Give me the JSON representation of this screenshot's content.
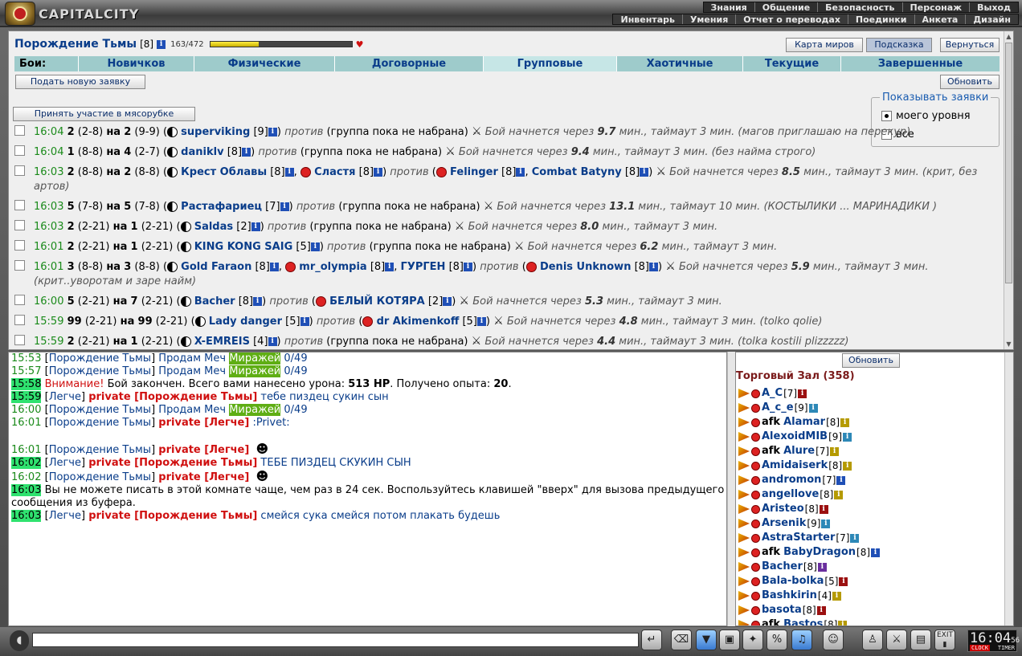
{
  "app": {
    "brand": "CAPITALCITY"
  },
  "menu_top": [
    "Знания",
    "Общение",
    "Безопасность",
    "Персонаж",
    "Выход"
  ],
  "menu_sub": [
    "Инвентарь",
    "Умения",
    "Отчет о переводах",
    "Поединки",
    "Анкета",
    "Дизайн"
  ],
  "header": {
    "nick": "Порождение Тьмы",
    "level": "[8]",
    "hp_text": "163/472",
    "hp_fraction": 0.345
  },
  "buttons": {
    "map": "Карта миров",
    "hint": "Подсказка",
    "back": "Вернуться",
    "new_request": "Подать новую заявку",
    "refresh": "Обновить",
    "join": "Принять участие в мясорубке"
  },
  "tabs": {
    "label": "Бои:",
    "items": [
      "Новичков",
      "Физические",
      "Договорные",
      "Групповые",
      "Хаотичные",
      "Текущие",
      "Завершенные"
    ],
    "selected": "Групповые"
  },
  "show_box": {
    "title": "Показывать заявки",
    "opt1": "моего уровня",
    "opt2": "все"
  },
  "fights": [
    {
      "time": "16:04",
      "a": "2",
      "ar": "(2-8)",
      "b": "2",
      "br": "(9-9)",
      "lead": "superviking",
      "lvl": "[9]",
      "vs": "(группа пока не набрана)",
      "mins": "9.7",
      "tmo": "3",
      "note": "(магов приглашаю на перекур)"
    },
    {
      "time": "16:04",
      "a": "1",
      "ar": "(8-8)",
      "b": "4",
      "br": "(2-7)",
      "lead": "daniklv",
      "lvl": "[8]",
      "vs": "(группа пока не набрана)",
      "mins": "9.4",
      "tmo": "3",
      "note": "(без найма строго)"
    },
    {
      "time": "16:03",
      "a": "2",
      "ar": "(8-8)",
      "b": "2",
      "br": "(8-8)",
      "lead": "Крест Облавы",
      "lvl": "[8]",
      "lead2": "Сластя",
      "lvl2": "[8]",
      "vs1": "Felinger",
      "vsl1": "[8]",
      "vs2": "Combat Batyny",
      "vsl2": "[8]",
      "mins": "8.5",
      "tmo": "3",
      "note": "(крит, без артов)"
    },
    {
      "time": "16:03",
      "a": "5",
      "ar": "(7-8)",
      "b": "5",
      "br": "(7-8)",
      "lead": "Растафариец",
      "lvl": "[7]",
      "vs": "(группа пока не набрана)",
      "mins": "13.1",
      "tmo": "10",
      "note": "(КОСТЫЛИКИ ... МАРИНАДИКИ )"
    },
    {
      "time": "16:03",
      "a": "2",
      "ar": "(2-21)",
      "b": "1",
      "br": "(2-21)",
      "lead": "Saldas",
      "lvl": "[2]",
      "vs": "(группа пока не набрана)",
      "mins": "8.0",
      "tmo": "3",
      "note": ""
    },
    {
      "time": "16:01",
      "a": "2",
      "ar": "(2-21)",
      "b": "1",
      "br": "(2-21)",
      "lead": "KING KONG SAIG",
      "lvl": "[5]",
      "vs": "(группа пока не набрана)",
      "mins": "6.2",
      "tmo": "3",
      "note": ""
    },
    {
      "time": "16:01",
      "a": "3",
      "ar": "(8-8)",
      "b": "3",
      "br": "(8-8)",
      "lead": "Gold Faraon",
      "lvl": "[8]",
      "lead2": "mr_olympia",
      "lvl2": "[8]",
      "lead3": "ГУРГЕН",
      "lvl3": "[8]",
      "vs1": "Denis Unknown",
      "vsl1": "[8]",
      "mins": "5.9",
      "tmo": "3",
      "note": "(крит..уворотам и заре найм)"
    },
    {
      "time": "16:00",
      "a": "5",
      "ar": "(2-21)",
      "b": "7",
      "br": "(2-21)",
      "lead": "Bacher",
      "lvl": "[8]",
      "vs1": "БЕЛЫЙ КОТЯРА",
      "vsl1": "[2]",
      "mins": "5.3",
      "tmo": "3",
      "note": ""
    },
    {
      "time": "15:59",
      "a": "99",
      "ar": "(2-21)",
      "b": "99",
      "br": "(2-21)",
      "lead": "Lady danger",
      "lvl": "[5]",
      "vs1": "dr Akimenkoff",
      "vsl1": "[5]",
      "mins": "4.8",
      "tmo": "3",
      "note": "(tolko qolie)"
    },
    {
      "time": "15:59",
      "a": "2",
      "ar": "(2-21)",
      "b": "1",
      "br": "(2-21)",
      "lead": "X-EMREIS",
      "lvl": "[4]",
      "vs": "(группа пока не набрана)",
      "mins": "4.4",
      "tmo": "3",
      "note": "(tolka kostili plizzzzz)"
    }
  ],
  "fight_text": {
    "vs_word": "против",
    "starts": "Бой начнется через",
    "mins": "мин., таймаут",
    "mins_end": "мин.",
    "on": "на"
  },
  "chat": [
    {
      "time": "15:53",
      "hl": false,
      "nick": "Порождение Тьмы",
      "text": "Продам Меч",
      "mir": "Миражей",
      "tail": "0/49"
    },
    {
      "time": "15:57",
      "hl": false,
      "nick": "Порождение Тьмы",
      "text": "Продам Меч",
      "mir": "Миражей",
      "tail": "0/49"
    },
    {
      "time": "15:58",
      "hl": true,
      "warn": "Внимание!",
      "text": "Бой закончен. Всего вами нанесено урона:",
      "dmg": "513 HP",
      "text2": ". Получено опыта:",
      "exp": "20",
      "text3": "."
    },
    {
      "time": "15:59",
      "hl": true,
      "nick": "Легче",
      "priv": "private [Порождение Тьмы]",
      "text": "тебе пиздец сукин сын"
    },
    {
      "time": "16:00",
      "hl": false,
      "nick": "Порождение Тьмы",
      "text": "Продам Меч",
      "mir": "Миражей",
      "tail": "0/49"
    },
    {
      "time": "16:01",
      "hl": false,
      "nick": "Порождение Тьмы",
      "priv": "private [Легче]",
      "text": ":Privet:"
    },
    {
      "time": "16:01",
      "hl": false,
      "nick": "Порождение Тьмы",
      "priv": "private [Легче]",
      "text": ""
    },
    {
      "time": "16:02",
      "hl": true,
      "nick": "Легче",
      "priv": "private [Порождение Тьмы]",
      "text": "ТЕБЕ ПИЗДЕЦ СКУКИН СЫН"
    },
    {
      "time": "16:02",
      "hl": false,
      "nick": "Порождение Тьмы",
      "priv": "private [Легче]",
      "text": ""
    },
    {
      "time": "16:03",
      "hl": true,
      "text": "Вы не можете писать в этой комнате чаще, чем раз в 24 сек. Воспользуйтесь клавишей \"вверх\" для вызова предыдущего сообщения из буфера."
    },
    {
      "time": "16:03",
      "hl": true,
      "nick": "Легче",
      "priv": "private [Порождение Тьмы]",
      "text": "смейся сука смейся потом плакать будешь"
    }
  ],
  "room": {
    "refresh": "Обновить",
    "title": "Торговый Зал (358)"
  },
  "users": [
    {
      "afk": "",
      "name": "A_C",
      "lvl": "[7]",
      "info": "red"
    },
    {
      "afk": "",
      "name": "A_c_e",
      "lvl": "[9]",
      "info": "cyan"
    },
    {
      "afk": "afk",
      "name": "Alamar",
      "lvl": "[8]",
      "info": "yel"
    },
    {
      "afk": "",
      "name": "AlexoidMIB",
      "lvl": "[9]",
      "info": "cyan"
    },
    {
      "afk": "afk",
      "name": "Alure",
      "lvl": "[7]",
      "info": "yel"
    },
    {
      "afk": "",
      "name": "Amidaiserk",
      "lvl": "[8]",
      "info": "yel"
    },
    {
      "afk": "",
      "name": "andromon",
      "lvl": "[7]",
      "info": "blue"
    },
    {
      "afk": "",
      "name": "angellove",
      "lvl": "[8]",
      "info": "yel"
    },
    {
      "afk": "",
      "name": "Aristeo",
      "lvl": "[8]",
      "info": "red"
    },
    {
      "afk": "",
      "name": "Arsenik",
      "lvl": "[9]",
      "info": "cyan"
    },
    {
      "afk": "",
      "name": "AstraStarter",
      "lvl": "[7]",
      "info": "cyan"
    },
    {
      "afk": "afk",
      "name": "BabyDragon",
      "lvl": "[8]",
      "info": "blue"
    },
    {
      "afk": "",
      "name": "Bacher",
      "lvl": "[8]",
      "info": "pur"
    },
    {
      "afk": "",
      "name": "Bala-bolka",
      "lvl": "[5]",
      "info": "red"
    },
    {
      "afk": "",
      "name": "Bashkirin",
      "lvl": "[4]",
      "info": "yel"
    },
    {
      "afk": "",
      "name": "basota",
      "lvl": "[8]",
      "info": "red"
    },
    {
      "afk": "afk",
      "name": "Bastos",
      "lvl": "[8]",
      "info": "yel"
    }
  ],
  "clock": {
    "time": "16:04",
    "sec": "56",
    "l1": "CLOCK",
    "l2": "TIMER"
  }
}
